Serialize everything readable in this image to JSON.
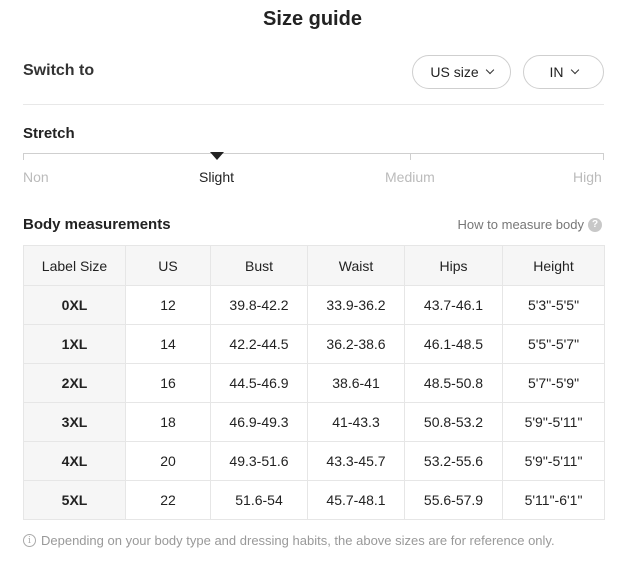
{
  "title": "Size guide",
  "switch": {
    "label": "Switch to",
    "size_system": "US size",
    "unit": "IN"
  },
  "stretch": {
    "title": "Stretch",
    "levels": [
      "Non",
      "Slight",
      "Medium",
      "High"
    ],
    "selected": "Slight"
  },
  "body_measurements": {
    "title": "Body measurements",
    "how_to": "How to measure body",
    "help_icon": "question-circle-icon"
  },
  "table": {
    "headers": [
      "Label Size",
      "US",
      "Bust",
      "Waist",
      "Hips",
      "Height"
    ],
    "rows": [
      [
        "0XL",
        "12",
        "39.8-42.2",
        "33.9-36.2",
        "43.7-46.1",
        "5'3\"-5'5\""
      ],
      [
        "1XL",
        "14",
        "42.2-44.5",
        "36.2-38.6",
        "46.1-48.5",
        "5'5\"-5'7\""
      ],
      [
        "2XL",
        "16",
        "44.5-46.9",
        "38.6-41",
        "48.5-50.8",
        "5'7\"-5'9\""
      ],
      [
        "3XL",
        "18",
        "46.9-49.3",
        "41-43.3",
        "50.8-53.2",
        "5'9\"-5'11\""
      ],
      [
        "4XL",
        "20",
        "49.3-51.6",
        "43.3-45.7",
        "53.2-55.6",
        "5'9\"-5'11\""
      ],
      [
        "5XL",
        "22",
        "51.6-54",
        "45.7-48.1",
        "55.6-57.9",
        "5'11\"-6'1\""
      ]
    ]
  },
  "note": {
    "icon": "info-circle-icon",
    "text": "Depending on your body type and dressing habits, the above sizes are for reference only."
  }
}
